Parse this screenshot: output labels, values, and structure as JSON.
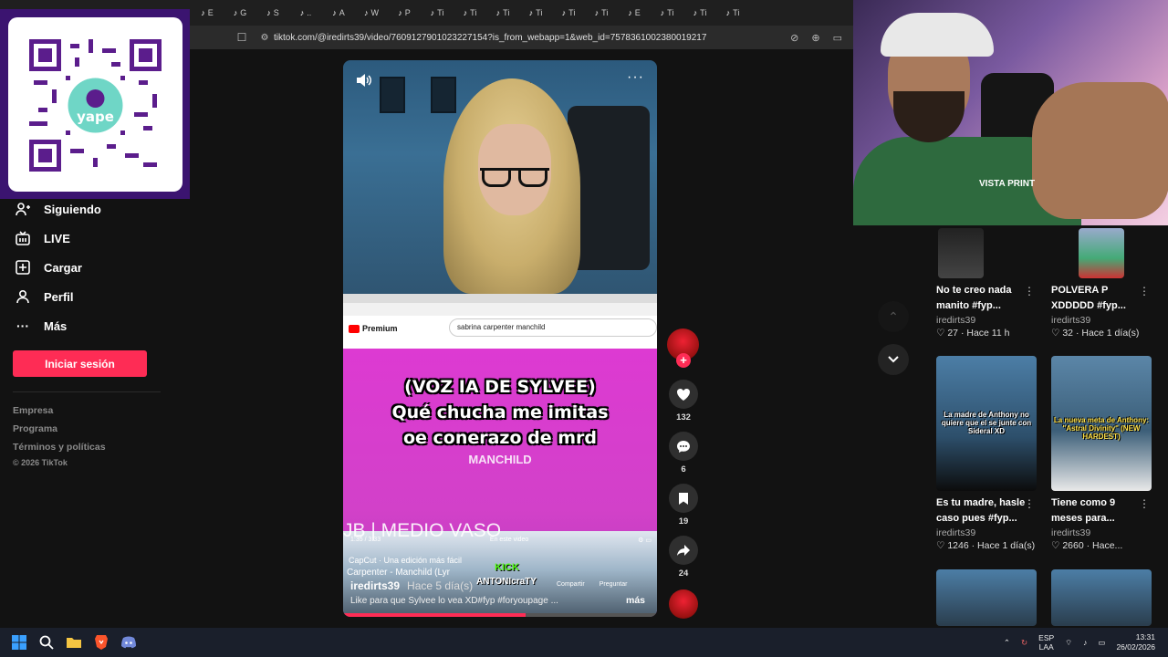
{
  "browser": {
    "tabs": [
      "E",
      "G",
      "S",
      "..",
      "A",
      "W",
      "P",
      "Ti",
      "Ti",
      "Ti",
      "Ti",
      "Ti",
      "Ti",
      "E",
      "Ti",
      "Ti",
      "Ti"
    ],
    "url": "tiktok.com/@iredirts39/video/7609127901023227154?is_from_webapp=1&web_id=7578361002380019217"
  },
  "sidebar": {
    "items": [
      {
        "label": "Siguiendo",
        "icon": "following-icon"
      },
      {
        "label": "LIVE",
        "icon": "live-icon"
      },
      {
        "label": "Cargar",
        "icon": "upload-icon"
      },
      {
        "label": "Perfil",
        "icon": "profile-icon"
      },
      {
        "label": "Más",
        "icon": "more-icon"
      }
    ],
    "login_label": "Iniciar sesión",
    "footer": [
      "Empresa",
      "Programa",
      "Términos y políticas"
    ],
    "copyright": "© 2026 TikTok"
  },
  "qr": {
    "brand": "yape"
  },
  "video": {
    "yt_search": "sabrina carpenter manchild",
    "yt_logo": "Premium",
    "caption_lines": [
      "(VOZ IA DE SYLVEE)",
      "Qué chucha me imitas",
      "oe conerazo de mrd"
    ],
    "under_caption": "MANCHILD",
    "medio_vaso": "JB | MEDIO VASO",
    "yt_time": "1:35 / 3:33",
    "yt_chapter": "En este video",
    "capcut": "CapCut · Una edición más fácil",
    "song": "Carpenter - Manchild (Lyr",
    "author": "iredirts39",
    "date": "Hace 5 día(s)",
    "kick": "KICK",
    "kick_name": "ANTONIcraTY",
    "yt_share": "Compartir",
    "yt_ask": "Preguntar",
    "description": "Like para que Sylvee lo vea XD#fyp #foryoupage ...",
    "more": "más",
    "progress": 0.58
  },
  "actions": {
    "likes": "132",
    "comments": "6",
    "saves": "19",
    "shares": "24"
  },
  "webcam": {
    "shirt": "VISTA PRINT"
  },
  "related": [
    {
      "title": "No te creo nada manito #fyp...",
      "user": "iredirts39",
      "likes": "27",
      "age": "Hace 11 h",
      "caption": ""
    },
    {
      "title": "POLVERA P XDDDDD #fyp...",
      "user": "iredirts39",
      "likes": "32",
      "age": "Hace 1 día(s)",
      "caption": ""
    },
    {
      "title": "Es tu madre, hasle caso pues #fyp...",
      "user": "iredirts39",
      "likes": "1246",
      "age": "Hace 1 día(s)",
      "caption": "La madre de Anthony no quiere que el se junte con Sideral XD"
    },
    {
      "title": "Tiene como 9 meses para...",
      "user": "iredirts39",
      "likes": "2660",
      "age": "Hace...",
      "caption": "La nueva meta de Anthony: \"Astral Divinity\" (NEW HARDEST)"
    }
  ],
  "taskbar": {
    "lang1": "ESP",
    "lang2": "LAA",
    "time": "13:31",
    "date": "26/02/2026"
  },
  "colors": {
    "accent": "#fe2c55",
    "bg": "#121212"
  }
}
